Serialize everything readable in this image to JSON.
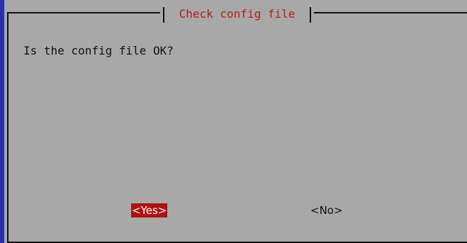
{
  "dialog": {
    "title": "Check config file",
    "message": "Is the config file OK?",
    "buttons": {
      "yes_label": "<Yes>",
      "no_label": "<No>"
    },
    "selected_button": "yes"
  },
  "colors": {
    "background": "#2a2fb0",
    "dialog": "#a8a8a8",
    "title_text": "#b01e1e",
    "selected_button_bg": "#b01010",
    "selected_button_text": "#ffffff"
  }
}
